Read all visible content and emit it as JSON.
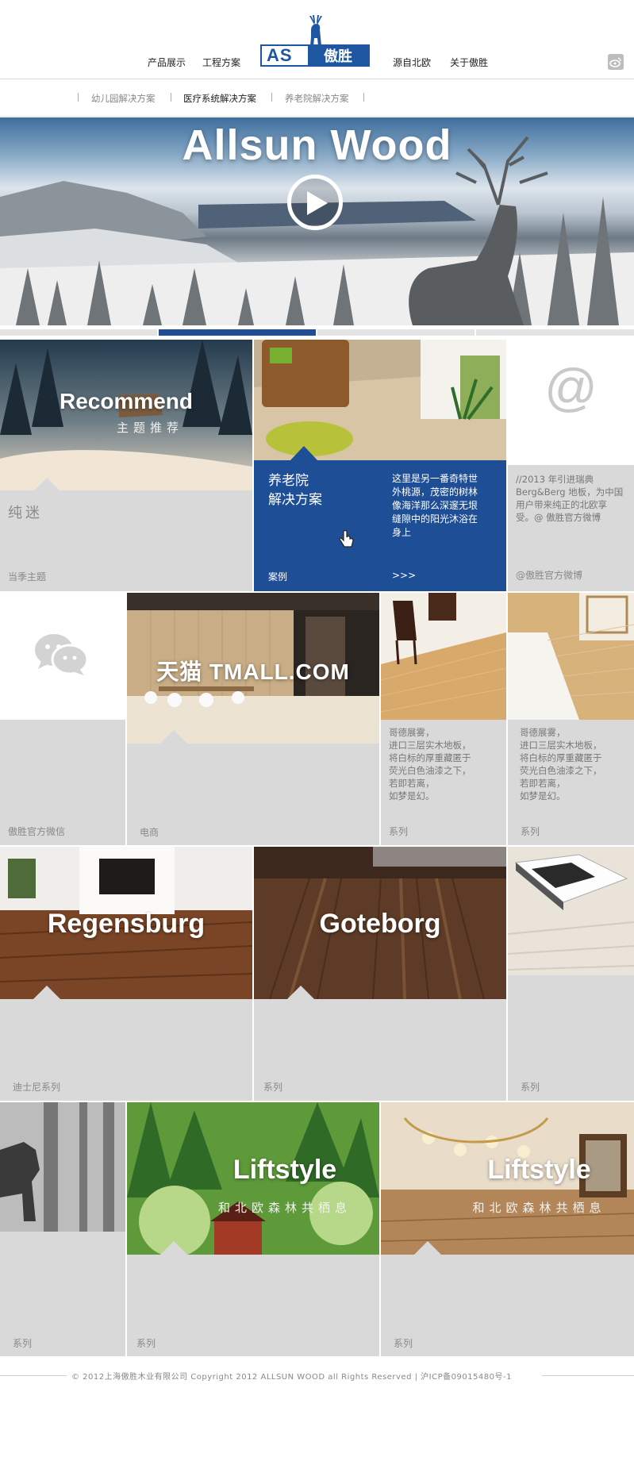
{
  "header": {
    "nav": [
      "产品展示",
      "工程方案",
      "源自北欧",
      "关于傲胜"
    ],
    "logo_latin": "AS",
    "logo_cn": "傲胜"
  },
  "subnav": {
    "items": [
      "幼儿园解决方案",
      "医疗系统解决方案",
      "养老院解决方案"
    ],
    "active": "医疗系统解决方案"
  },
  "banner": {
    "title": "Allsun Wood"
  },
  "tiles": {
    "recommend": {
      "title": "Recommend",
      "subtitle": "主题推荐",
      "text": "纯迷",
      "label": "当季主题"
    },
    "elder": {
      "title_line1": "养老院",
      "title_line2": "解决方案",
      "desc": "这里是另一番奇特世\n外桃源，茂密的树林\n像海洋那么深邃无垠\n缝隙中的阳光沐浴在\n身上",
      "label": "案例",
      "more": ">>>"
    },
    "weibo": {
      "symbol": "@",
      "desc": "//2013 年引进瑞典\nBerg&Berg 地板，为中国\n用户带来纯正的北欧享\n受。@ 傲胜官方微博",
      "label": "@傲胜官方微博"
    },
    "wechat": {
      "label": "傲胜官方微信"
    },
    "tmall": {
      "title": "天猫 TMALL.COM",
      "label": "电商"
    },
    "series_a": {
      "desc": "哥德展雾，\n进口三层实木地板，\n将白标的厚重藏匿于\n荧光白色油漆之下，\n若即若离，\n如梦是幻。",
      "label": "系列"
    },
    "series_b": {
      "desc": "哥德展雾，\n进口三层实木地板，\n将白标的厚重藏匿于\n荧光白色油漆之下，\n若即若离，\n如梦是幻。",
      "label": "系列"
    },
    "regensburg": {
      "title": "Regensburg",
      "label": "迪士尼系列"
    },
    "goteborg": {
      "title": "Goteborg",
      "label": "系列"
    },
    "book": {
      "label": "系列"
    },
    "deer": {
      "label": "系列"
    },
    "liftstyle1": {
      "title": "Liftstyle",
      "subtitle": "和北欧森林共栖息",
      "label": "系列"
    },
    "liftstyle2": {
      "title": "Liftstyle",
      "subtitle": "和北欧森林共栖息",
      "label": "系列"
    }
  },
  "footer": {
    "text": "© 2012上海傲胜木业有限公司 Copyright 2012 ALLSUN WOOD all Rights Reserved  |  沪ICP备09015480号-1"
  },
  "colors": {
    "brand_blue": "#1f4e96",
    "tile_gray": "#d9d9d9"
  }
}
